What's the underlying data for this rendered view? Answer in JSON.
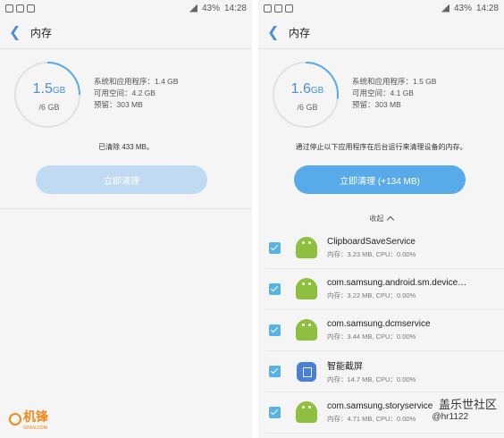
{
  "status": {
    "time": "14:28",
    "battery": "43%"
  },
  "left": {
    "title": "内存",
    "ring_value": "1.5",
    "ring_unit": "GB",
    "ring_total": "/6 GB",
    "stat_system": "系统和应用程序：1.4 GB",
    "stat_free": "可用空间：4.2 GB",
    "stat_reserved": "预留：303 MB",
    "message": "已清除 433 MB。",
    "button": "立即清理",
    "ring_fraction": 0.25
  },
  "right": {
    "title": "内存",
    "ring_value": "1.6",
    "ring_unit": "GB",
    "ring_total": "/6 GB",
    "stat_system": "系统和应用程序：1.5 GB",
    "stat_free": "可用空间：4.1 GB",
    "stat_reserved": "预留：303 MB",
    "message": "通过停止以下应用程序在后台运行来清理设备的内存。",
    "button": "立即清理 (+134 MB)",
    "collapse_label": "收起",
    "processes": [
      {
        "name": "ClipboardSaveService",
        "mem": "内存：3.23 MB, CPU：0.00%",
        "icon": "android-icon"
      },
      {
        "name": "com.samsung.android.sm.device…",
        "mem": "内存：3.22 MB, CPU：0.00%",
        "icon": "android-icon"
      },
      {
        "name": "com.samsung.dcmservice",
        "mem": "内存：3.44 MB, CPU：0.00%",
        "icon": "android-icon"
      },
      {
        "name": "智能截屏",
        "mem": "内存：14.7 MB, CPU：0.00%",
        "icon": "smart-capture-icon"
      },
      {
        "name": "com.samsung.storyservice",
        "mem": "内存：4.71 MB, CPU：0.00%",
        "icon": "android-icon"
      }
    ],
    "ring_fraction": 0.27
  },
  "watermark": {
    "logo": "机锋",
    "logo_sub": "GFAN.COM",
    "community": "盖乐世社区",
    "user": "@hr1122"
  },
  "colors": {
    "accent": "#4a8fd6",
    "button_active": "#58abe8",
    "button_disabled": "#bfdaf2",
    "checkbox": "#57b2e6"
  }
}
